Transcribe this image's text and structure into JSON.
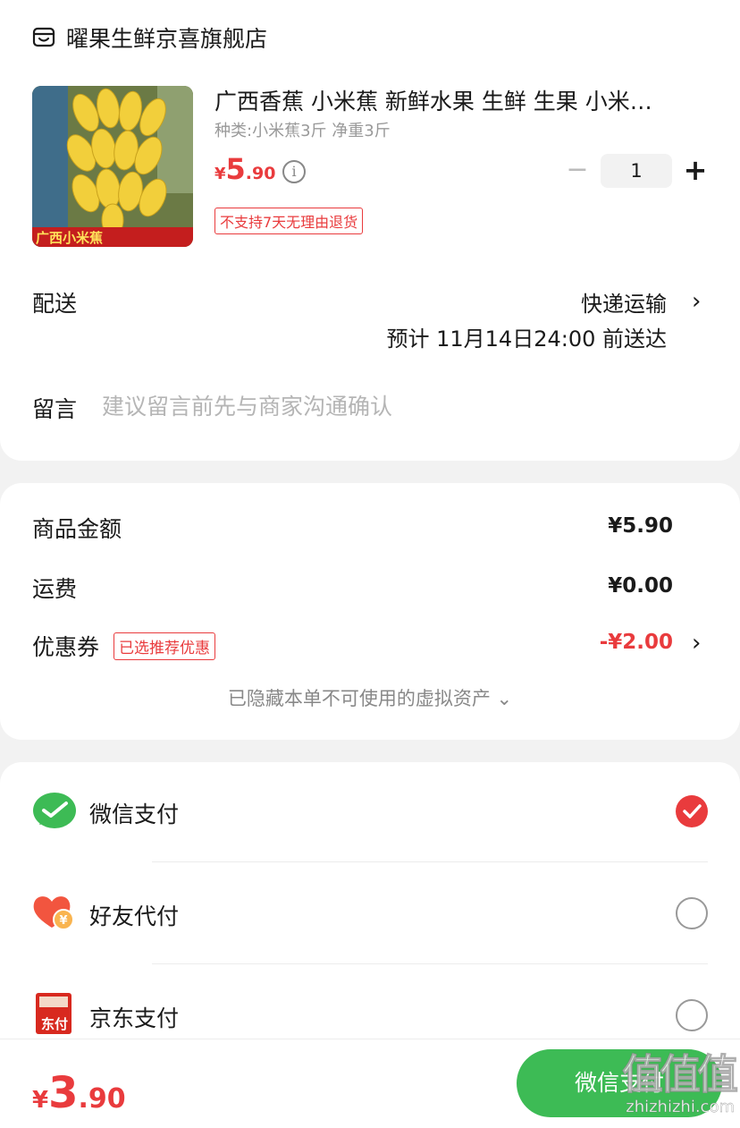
{
  "store": {
    "name": "曜果生鲜京喜旗舰店",
    "icon": "store-icon"
  },
  "product": {
    "title": "广西香蕉 小米蕉   新鲜水果 生鲜 生果 小米…",
    "spec": "种类:小米蕉3斤 净重3斤",
    "price_symbol": "¥",
    "price_int": "5",
    "price_dec": ".90",
    "image_caption": "广西小米蕉",
    "quantity": "1",
    "minus": "−",
    "plus": "+",
    "return_policy": "不支持7天无理由退货"
  },
  "delivery": {
    "label": "配送",
    "method": "快递运输",
    "eta": "预计 11月14日24:00 前送达"
  },
  "remark": {
    "label": "留言",
    "placeholder": "建议留言前先与商家沟通确认"
  },
  "summary": {
    "goods_label": "商品金额",
    "goods_amount": "¥5.90",
    "shipping_label": "运费",
    "shipping_amount": "¥0.00",
    "coupon_label": "优惠券",
    "coupon_badge": "已选推荐优惠",
    "coupon_amount": "-¥2.00",
    "hidden_assets": "已隐藏本单不可使用的虚拟资产 ⌄"
  },
  "payment_methods": [
    {
      "label": "微信支付",
      "icon": "wechat-pay-icon",
      "selected": true
    },
    {
      "label": "好友代付",
      "icon": "friend-pay-icon",
      "selected": false
    },
    {
      "label": "京东支付",
      "icon": "jd-pay-icon",
      "selected": false
    }
  ],
  "jd_pay_icon_text": "东付",
  "footer": {
    "total_symbol": "¥",
    "total_int": "3",
    "total_dec": ".90",
    "pay_button": "微信支付"
  },
  "watermark": {
    "main": "值值值",
    "sub": "zhizhizhi.com"
  },
  "colors": {
    "accent": "#e93b3d",
    "wechat_green": "#3dbb55",
    "background": "#f2f2f2"
  }
}
